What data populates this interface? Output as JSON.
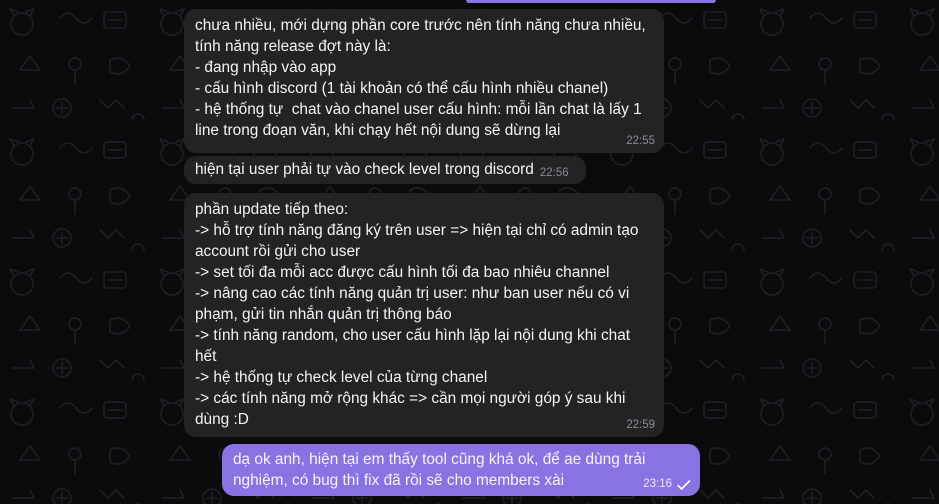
{
  "theme": {
    "background": "#0b0b0d",
    "incoming_bubble": "#232326",
    "outgoing_bubble": "#8a72e3",
    "text": "#f4f4f6",
    "timestamp": "#8b8b90"
  },
  "messages": [
    {
      "direction": "incoming",
      "lines": [
        "chưa nhiều, mới dựng phần core trước nên tính năng chưa nhiều,",
        "tính năng release đợt này là:",
        "- đang nhập vào app",
        "- cấu hình discord (1 tài khoản có thể cấu hình nhiều chanel)",
        "- hệ thống tự  chat vào chanel user cấu hình: mỗi lần chat là lấy 1",
        "line trong đoạn văn, khi chạy hết nội dung sẽ dừng lại"
      ],
      "time": "22:55"
    },
    {
      "direction": "incoming",
      "lines": [
        "hiện tại user phải tự vào check level trong discord"
      ],
      "time": "22:56"
    },
    {
      "direction": "incoming",
      "lines": [
        "phần update tiếp theo:",
        "-> hỗ trợ tính năng đăng ký trên user => hiện tại chỉ có admin tạo",
        "account rồi gửi cho user",
        "-> set tối đa mỗi acc được cấu hình tối đa bao nhiêu channel",
        "-> nâng cao các tính năng quản trị user: như ban user nếu có vi",
        "phạm, gửi tin nhắn quản trị thông báo",
        "-> tính năng random, cho user cấu hình lặp lại nội dung khi chat",
        "hết",
        "-> hệ thống tự check level của từng chanel",
        "-> các tính năng mở rộng khác => cần mọi người góp ý sau khi",
        "dùng :D"
      ],
      "time": "22:59"
    },
    {
      "direction": "outgoing",
      "lines": [
        "dạ ok anh, hiện tại em thấy tool cũng khá ok, để ae dùng trải",
        "nghiệm, có bug thì fix đã rồi sẽ cho members xài"
      ],
      "time": "23:16",
      "status_icon": "double-check-icon"
    }
  ]
}
